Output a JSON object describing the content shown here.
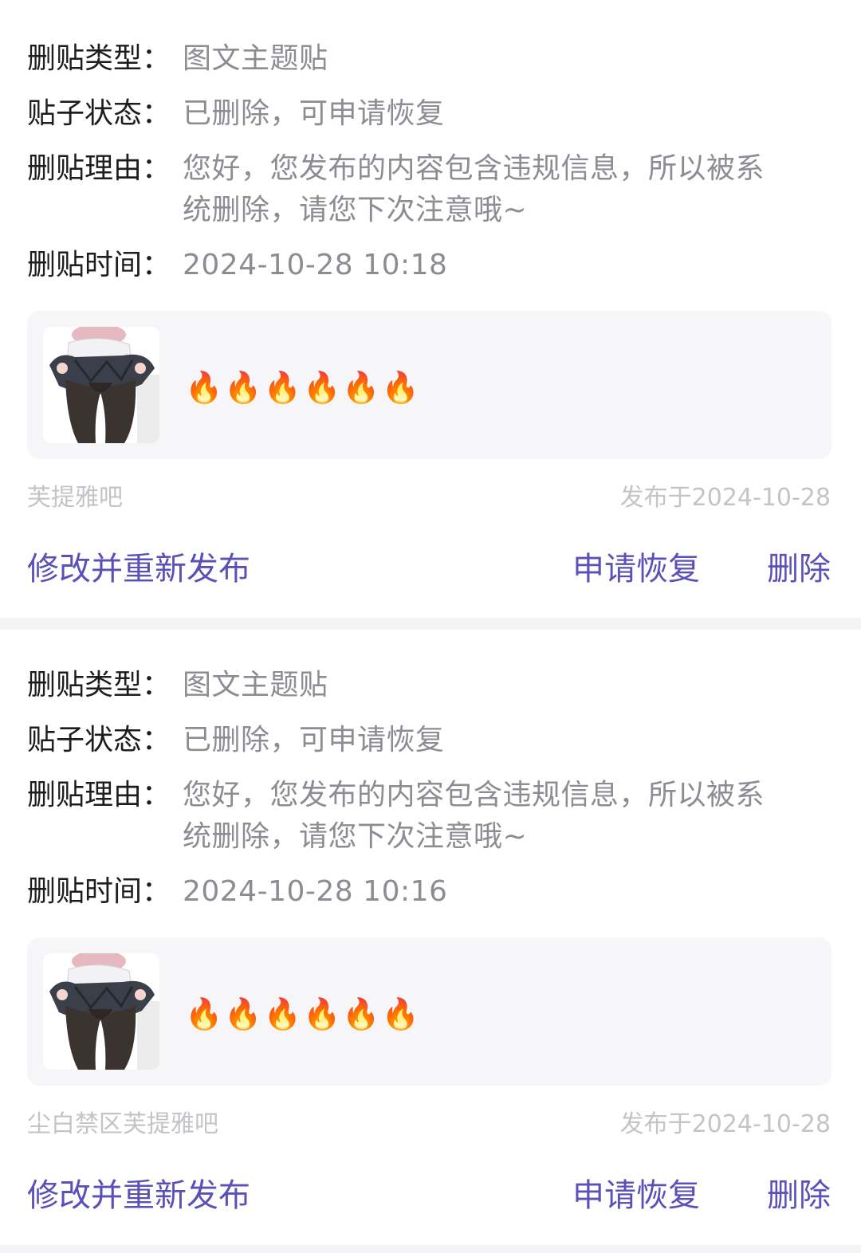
{
  "colors": {
    "accent": "#6a5ae0",
    "action": "#5b50b8",
    "label": "#1d1d1f",
    "value": "#8c8c92",
    "meta": "#c4c4c8",
    "post_bg": "#f6f6f8",
    "divider": "#f4f4f6"
  },
  "labels": {
    "type": "删贴类型：",
    "status": "贴子状态：",
    "reason": "删贴理由：",
    "time": "删贴时间："
  },
  "posts": [
    {
      "type": "图文主题贴",
      "status": "已删除，可申请恢复",
      "reason": "您好，您发布的内容包含违规信息，所以被系统删除，请您下次注意哦~",
      "time": "2024-10-28 10:18",
      "thumbnail_icon": "anime-girl-thumbnail",
      "content": "🔥🔥🔥🔥🔥🔥",
      "forum": "芙提雅吧",
      "published": "发布于2024-10-28",
      "actions": {
        "edit": "修改并重新发布",
        "restore": "申请恢复",
        "delete": "删除"
      }
    },
    {
      "type": "图文主题贴",
      "status": "已删除，可申请恢复",
      "reason": "您好，您发布的内容包含违规信息，所以被系统删除，请您下次注意哦~",
      "time": "2024-10-28 10:16",
      "thumbnail_icon": "anime-girl-thumbnail",
      "content": "🔥🔥🔥🔥🔥🔥",
      "forum": "尘白禁区芙提雅吧",
      "published": "发布于2024-10-28",
      "actions": {
        "edit": "修改并重新发布",
        "restore": "申请恢复",
        "delete": "删除"
      }
    }
  ]
}
